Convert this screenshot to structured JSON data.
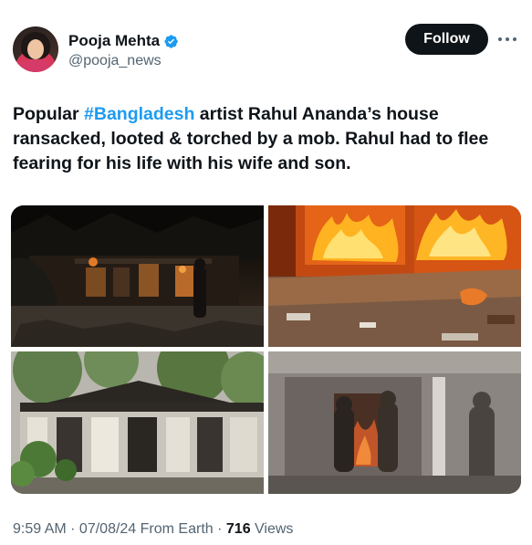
{
  "author": {
    "display_name": "Pooja Mehta",
    "handle": "@pooja_news",
    "verified": true
  },
  "actions": {
    "follow_label": "Follow"
  },
  "tweet": {
    "text_prefix": "Popular ",
    "hashtag": "#Bangladesh",
    "text_suffix": " artist Rahul Ananda’s house ransacked, looted & torched by a mob. Rahul had to flee fearing for his life with his wife and son."
  },
  "meta": {
    "time": "9:59 AM",
    "sep1": " · ",
    "date": "07/08/24",
    "source": " From Earth",
    "sep2": " · ",
    "views_count": "716",
    "views_label": " Views"
  },
  "icons": {
    "verified": "verified-badge-icon",
    "more": "more-dots-icon"
  },
  "colors": {
    "accent": "#1d9bf0",
    "text": "#0f1419",
    "secondary": "#536471"
  }
}
